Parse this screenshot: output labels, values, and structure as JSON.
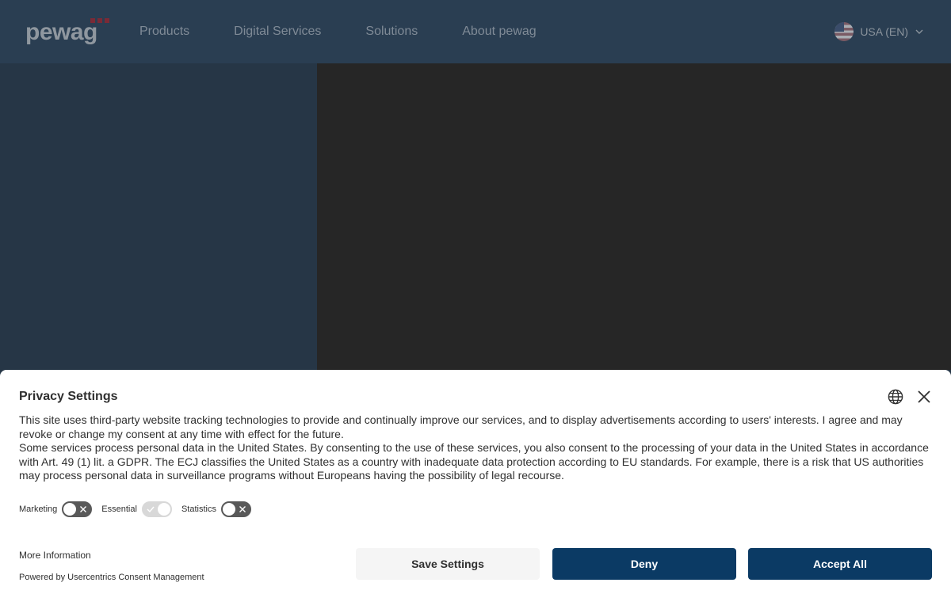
{
  "header": {
    "logo_text": "pewag",
    "nav": [
      "Products",
      "Digital Services",
      "Solutions",
      "About pewag"
    ],
    "locale": "USA (EN)"
  },
  "consent": {
    "title": "Privacy Settings",
    "paragraph1": "This site uses third-party website tracking technologies to provide and continually improve our services, and to display advertisements according to users' interests. I agree and may revoke or change my consent at any time with effect for the future.",
    "paragraph2": "Some services process personal data in the United States. By consenting to the use of these services, you also consent to the processing of your data in the United States in accordance with Art. 49 (1) lit. a GDPR. The ECJ classifies the United States as a country with inadequate data protection according to EU standards. For example, there is a risk that US authorities may process personal data in surveillance programs without Europeans having the possibility of legal recourse.",
    "toggles": [
      {
        "label": "Marketing",
        "state": "off"
      },
      {
        "label": "Essential",
        "state": "on"
      },
      {
        "label": "Statistics",
        "state": "off"
      }
    ],
    "more_info": "More Information",
    "powered_by": "Powered by Usercentrics Consent Management",
    "buttons": {
      "save": "Save Settings",
      "deny": "Deny",
      "accept": "Accept All"
    }
  },
  "colors": {
    "header_bg": "#2a3e52",
    "hero_bg": "#262626",
    "primary_button": "#0b3a64",
    "logo_accent": "#7a2a36"
  },
  "icons": [
    "globe-icon",
    "close-icon",
    "chevron-down-icon",
    "us-flag-icon",
    "check-icon",
    "x-icon"
  ]
}
